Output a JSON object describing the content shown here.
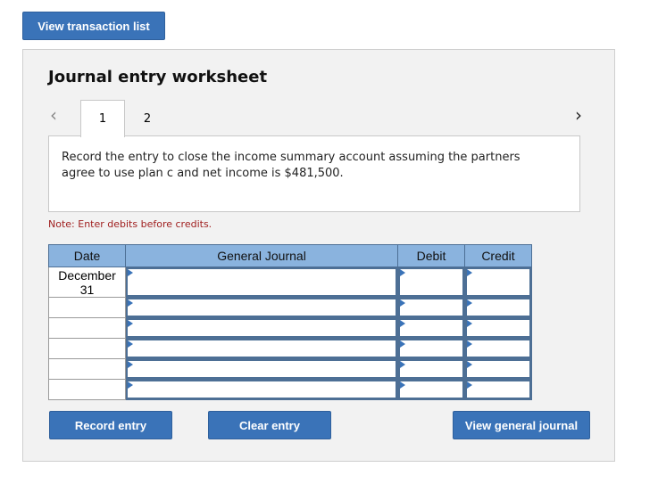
{
  "header": {
    "view_transaction_list": "View transaction list"
  },
  "worksheet": {
    "title": "Journal entry worksheet",
    "nav": {
      "prev_icon": "chevron-left-icon",
      "next_icon": "chevron-right-icon"
    },
    "tabs": [
      {
        "label": "1",
        "active": true
      },
      {
        "label": "2",
        "active": false
      }
    ],
    "description_line1": "Record the entry to close the income summary account assuming the partners",
    "description_line2": "agree to use plan c and net income is $481,500.",
    "note": "Note: Enter debits before credits.",
    "table": {
      "headers": {
        "date": "Date",
        "general_journal": "General Journal",
        "debit": "Debit",
        "credit": "Credit"
      },
      "rows": [
        {
          "date_line1": "December",
          "date_line2": "31",
          "account": "",
          "debit": "",
          "credit": ""
        },
        {
          "date_line1": "",
          "date_line2": "",
          "account": "",
          "debit": "",
          "credit": ""
        },
        {
          "date_line1": "",
          "date_line2": "",
          "account": "",
          "debit": "",
          "credit": ""
        },
        {
          "date_line1": "",
          "date_line2": "",
          "account": "",
          "debit": "",
          "credit": ""
        },
        {
          "date_line1": "",
          "date_line2": "",
          "account": "",
          "debit": "",
          "credit": ""
        },
        {
          "date_line1": "",
          "date_line2": "",
          "account": "",
          "debit": "",
          "credit": ""
        }
      ]
    },
    "buttons": {
      "record_entry": "Record entry",
      "clear_entry": "Clear entry",
      "view_general_journal": "View general journal"
    }
  },
  "colors": {
    "button_blue": "#3a73b8",
    "table_header": "#8ab3de",
    "note_red": "#a01f1f",
    "panel_bg": "#f2f2f2"
  }
}
